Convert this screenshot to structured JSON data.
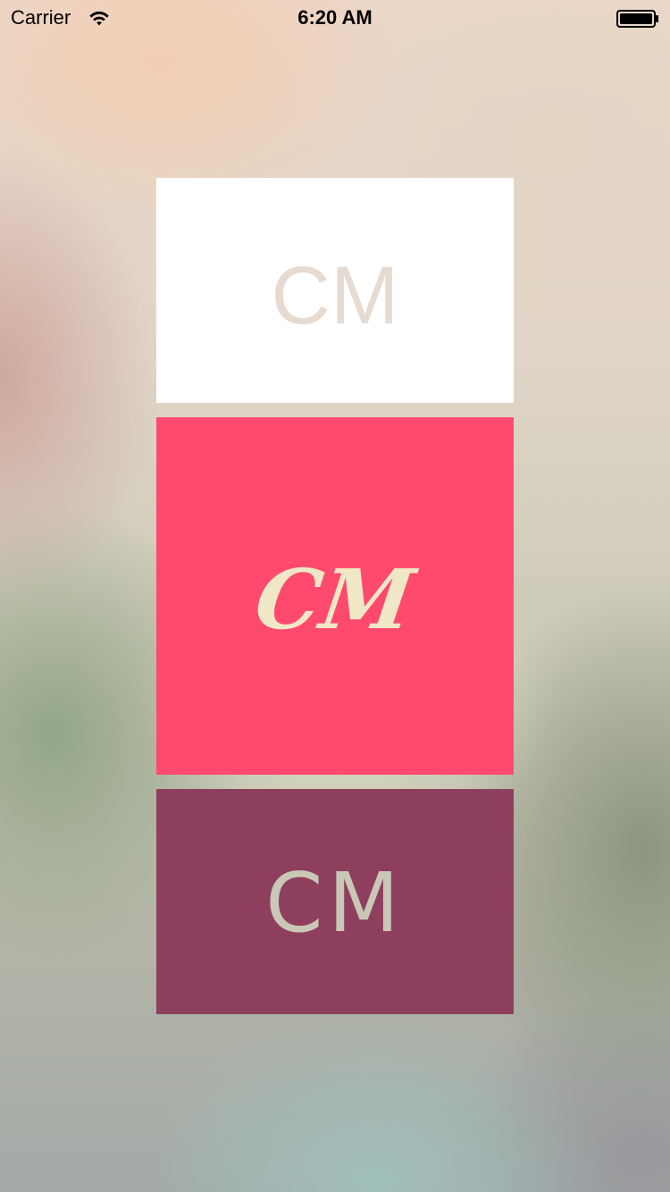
{
  "status_bar": {
    "carrier": "Carrier",
    "time": "6:20 AM",
    "wifi_icon": "wifi-icon",
    "battery_icon": "battery-icon"
  },
  "logos": [
    {
      "text": "CM",
      "background": "#ffffff",
      "text_color": "#e7dbd1"
    },
    {
      "text": "CM",
      "background": "#ff4a6e",
      "text_color": "#efe7c6"
    },
    {
      "text": "CM",
      "background": "#8e3f5e",
      "text_color": "#c9c8b6"
    }
  ]
}
